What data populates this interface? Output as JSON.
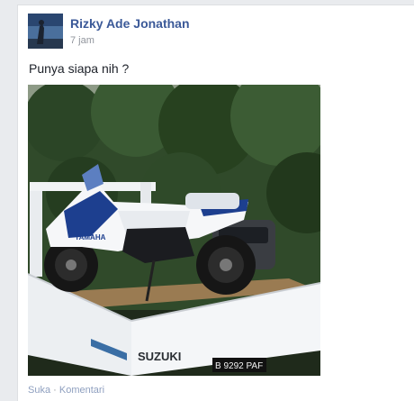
{
  "post": {
    "author": "Rizky Ade Jonathan",
    "time": "7 jam",
    "text": "Punya siapa nih ?"
  },
  "photo": {
    "truck_brand": "SUZUKI",
    "plate": "B 9292 PAF",
    "bike_brand": "YAMAHA"
  },
  "actions": {
    "like": "Suka",
    "separator": "·",
    "comment": "Komentari"
  },
  "colors": {
    "link": "#3b5998",
    "muted": "#90949c"
  }
}
